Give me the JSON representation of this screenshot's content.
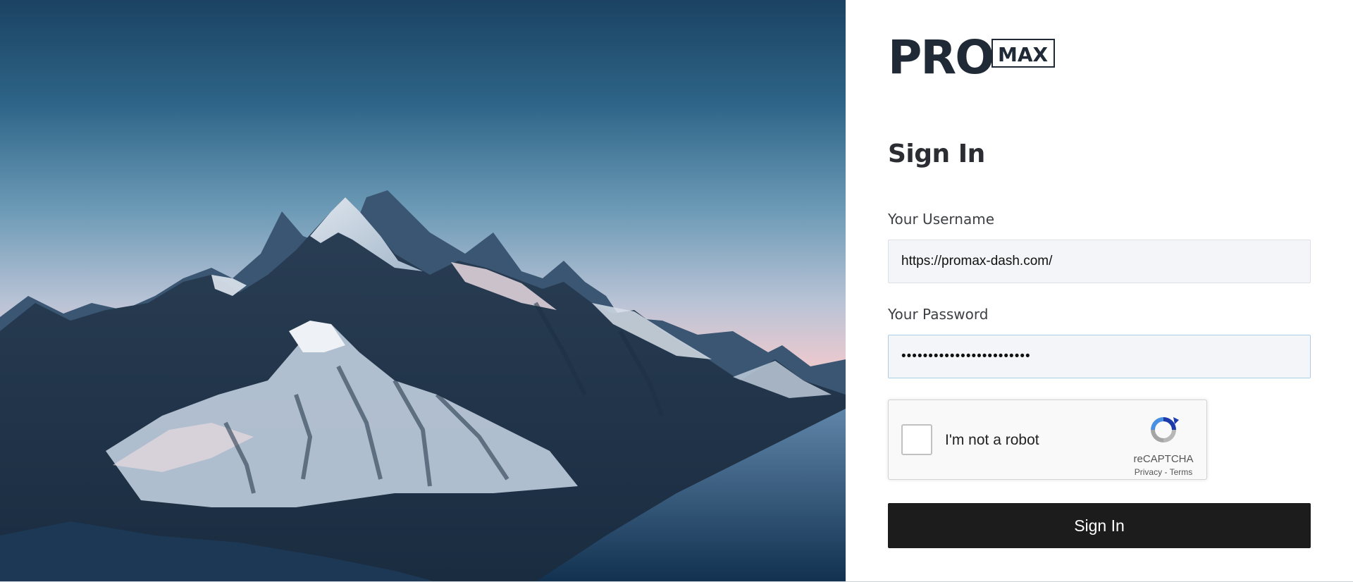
{
  "brand": {
    "logo_text": "PRO",
    "logo_sub": "MAX"
  },
  "hero": {
    "image": "snowy-mountain-range-at-dusk"
  },
  "form": {
    "title": "Sign In",
    "username_label": "Your Username",
    "username_value": "https://promax-dash.com/",
    "password_label": "Your Password",
    "password_value": "••••••••••••••••••••••••",
    "submit_label": "Sign In"
  },
  "captcha": {
    "label": "I'm not a robot",
    "brand": "reCAPTCHA",
    "privacy": "Privacy",
    "separator": " - ",
    "terms": "Terms"
  },
  "colors": {
    "button_bg": "#1c1c1c",
    "field_bg": "#f4f5f8",
    "focus_border": "#a9cfe8",
    "title": "#2b2d33"
  }
}
